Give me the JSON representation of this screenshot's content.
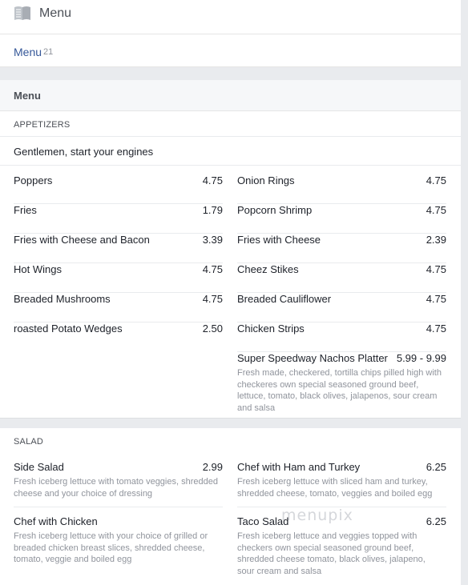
{
  "header": {
    "title": "Menu",
    "icon": "book-icon"
  },
  "tabs": {
    "active_label": "Menu",
    "count": "21"
  },
  "section_title": "Menu",
  "categories": [
    {
      "title": "APPETIZERS",
      "description": "Gentlemen, start your engines",
      "left_items": [
        {
          "name": "Poppers",
          "price": "4.75"
        },
        {
          "name": "Fries",
          "price": "1.79"
        },
        {
          "name": "Fries with Cheese and Bacon",
          "price": "3.39"
        },
        {
          "name": "Hot Wings",
          "price": "4.75"
        },
        {
          "name": "Breaded Mushrooms",
          "price": "4.75"
        },
        {
          "name": "roasted Potato Wedges",
          "price": "2.50"
        }
      ],
      "right_items": [
        {
          "name": "Onion Rings",
          "price": "4.75"
        },
        {
          "name": "Popcorn Shrimp",
          "price": "4.75"
        },
        {
          "name": "Fries with Cheese",
          "price": "2.39"
        },
        {
          "name": "Cheez Stikes",
          "price": "4.75"
        },
        {
          "name": "Breaded Cauliflower",
          "price": "4.75"
        },
        {
          "name": "Chicken Strips",
          "price": "4.75"
        },
        {
          "name": "Super Speedway Nachos Platter",
          "price": "5.99 - 9.99",
          "description": "Fresh made, checkered, tortilla chips pilled high with checkeres own special seasoned ground beef, lettuce, tomato, black olives, jalapenos, sour cream and salsa"
        }
      ]
    },
    {
      "title": "SALAD",
      "left_items": [
        {
          "name": "Side Salad",
          "price": "2.99",
          "description": "Fresh iceberg lettuce with tomato veggies, shredded cheese and your choice of dressing"
        },
        {
          "name": "Chef with Chicken",
          "price": "",
          "description": "Fresh iceberg lettuce with your choice of grilled or breaded chicken breast slices, shredded cheese, tomato, veggie and boiled egg"
        }
      ],
      "right_items": [
        {
          "name": "Chef with Ham and Turkey",
          "price": "6.25",
          "description": "Fresh iceberg lettuce with sliced ham and turkey, shredded cheese, tomato, veggies and boiled egg"
        },
        {
          "name": "Taco Salad",
          "price": "6.25",
          "description": "Fresh iceberg lettuce and veggies topped with checkers own special seasoned ground beef, shredded cheese tomato, black olives, jalapeno, sour cream and salsa"
        }
      ]
    }
  ],
  "watermark": "menupix"
}
